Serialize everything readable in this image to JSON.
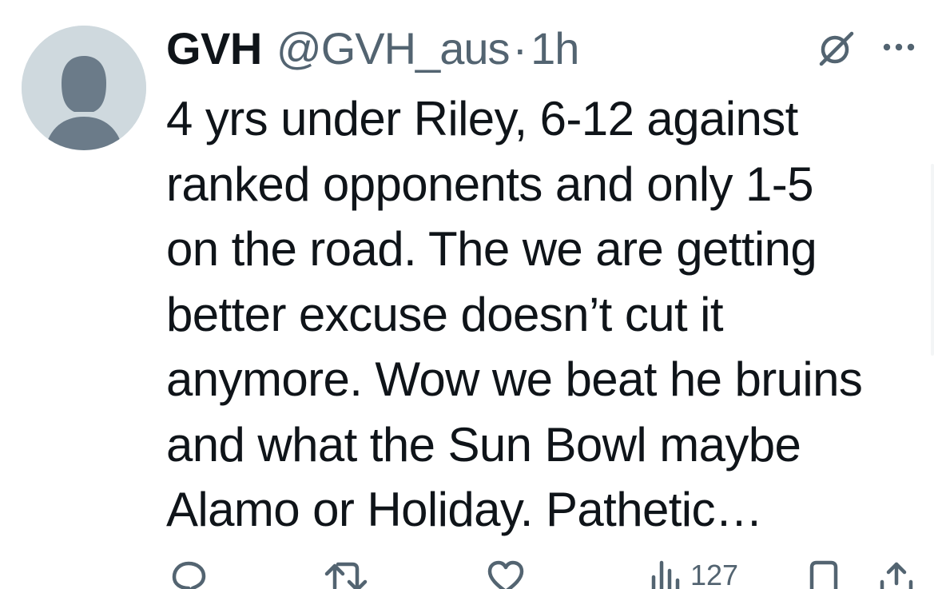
{
  "tweet": {
    "author": {
      "display_name": "GVH",
      "handle": "@GVH_aus",
      "avatar_icon": "default-avatar-icon"
    },
    "separator": "·",
    "timestamp": "1h",
    "text_lines": [
      "4 yrs under Riley, 6-12 against",
      "ranked opponents and only 1-5",
      "on the road. The we are getting",
      "better excuse doesn’t cut it",
      "anymore. Wow we beat he bruins",
      "and what the Sun Bowl maybe",
      "Alamo or Holiday. Pathetic…"
    ],
    "header_icons": [
      "grok-icon",
      "more-icon"
    ],
    "actions": {
      "reply_icon": "reply-icon",
      "retweet_icon": "retweet-icon",
      "like_icon": "like-icon",
      "views_icon": "views-icon",
      "views_count": "127",
      "bookmark_icon": "bookmark-icon",
      "share_icon": "share-icon"
    }
  },
  "colors": {
    "text_primary": "#0f1419",
    "text_secondary": "#536471",
    "avatar_bg": "#cfd9de",
    "avatar_figure": "#6b7b89",
    "background": "#ffffff"
  }
}
